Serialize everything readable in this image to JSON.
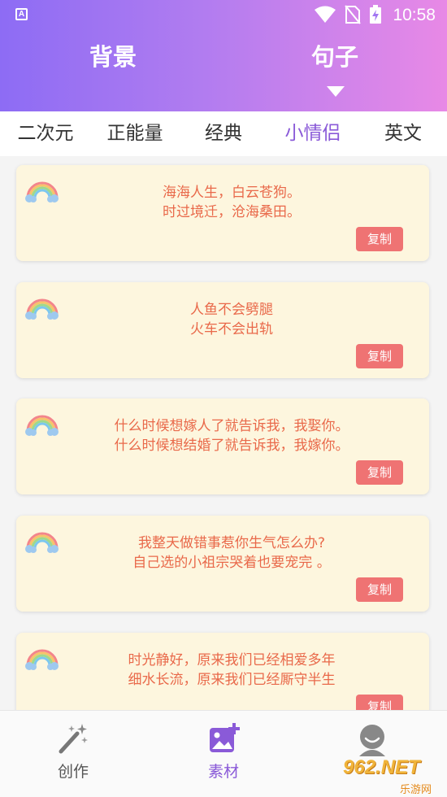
{
  "status_bar": {
    "app_icon_letter": "A",
    "time": "10:58"
  },
  "header": {
    "tabs": [
      "背景",
      "句子"
    ],
    "active_tab": "句子"
  },
  "categories": {
    "items": [
      "二次元",
      "正能量",
      "经典",
      "小情侣",
      "英文"
    ],
    "active": "小情侣"
  },
  "cards": [
    {
      "line1": "海海人生，白云苍狗。",
      "line2": "时过境迁，沧海桑田。",
      "copy_label": "复制"
    },
    {
      "line1": "人鱼不会劈腿",
      "line2": "火车不会出轨",
      "copy_label": "复制"
    },
    {
      "line1": "什么时候想嫁人了就告诉我，我娶你。",
      "line2": "什么时候想结婚了就告诉我，我嫁你。",
      "copy_label": "复制"
    },
    {
      "line1": "我整天做错事惹你生气怎么办?",
      "line2": "自己选的小祖宗哭着也要宠完 。",
      "copy_label": "复制"
    },
    {
      "line1": "时光静好，原来我们已经相爱多年",
      "line2": "细水长流，原来我们已经厮守半生",
      "copy_label": "复制"
    }
  ],
  "bottom_nav": {
    "items": [
      {
        "label": "创作",
        "icon": "magic-wand-icon"
      },
      {
        "label": "素材",
        "icon": "image-add-icon"
      },
      {
        "label": "",
        "icon": "profile-icon"
      }
    ],
    "active": "素材"
  },
  "watermark": {
    "text": "962.NET",
    "subtext": "乐游网"
  },
  "colors": {
    "header_gradient_start": "#8d6cf4",
    "header_gradient_end": "#e889e6",
    "accent": "#8a5ad8",
    "card_bg": "#fdf6de",
    "card_text": "#e9694a",
    "copy_button": "#ef7373"
  }
}
